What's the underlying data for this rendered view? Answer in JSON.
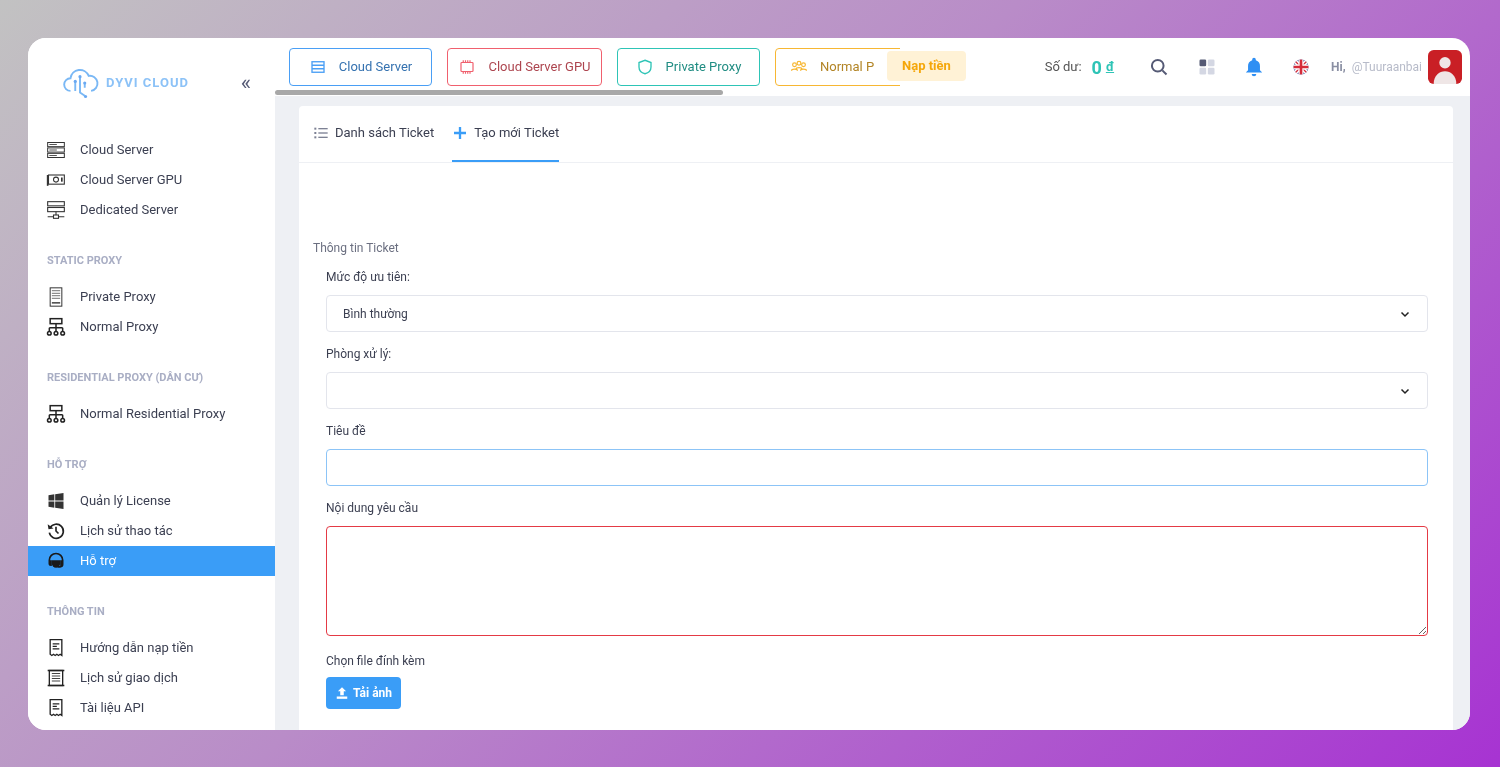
{
  "sidebar": {
    "logo": "DYVI CLOUD",
    "collapse": "«",
    "sections": [
      {
        "items": [
          {
            "label": "Cloud Server",
            "kind": "rack",
            "selected": false
          },
          {
            "label": "Cloud Server GPU",
            "kind": "gpu",
            "selected": false
          },
          {
            "label": "Dedicated Server",
            "kind": "dedicated",
            "selected": false
          }
        ]
      },
      {
        "heading": "STATIC PROXY",
        "items": [
          {
            "label": "Private Proxy",
            "kind": "panel",
            "selected": false
          },
          {
            "label": "Normal Proxy",
            "kind": "network",
            "selected": false
          }
        ]
      },
      {
        "heading": "RESIDENTIAL PROXY (DÂN CƯ)",
        "items": [
          {
            "label": "Normal Residential Proxy",
            "kind": "network",
            "selected": false
          }
        ]
      },
      {
        "heading": "HỖ TRỢ",
        "items": [
          {
            "label": "Quản lý License",
            "kind": "windows",
            "selected": false
          },
          {
            "label": "Lịch sử thao tác",
            "kind": "history",
            "selected": false
          },
          {
            "label": "Hỗ trợ",
            "kind": "headset",
            "selected": true
          }
        ]
      },
      {
        "heading": "THÔNG TIN",
        "items": [
          {
            "label": "Hướng dẫn nạp tiền",
            "kind": "receipt",
            "selected": false
          },
          {
            "label": "Lịch sử giao dịch",
            "kind": "scroll",
            "selected": false
          },
          {
            "label": "Tài liệu API",
            "kind": "receipt",
            "selected": false
          }
        ]
      }
    ]
  },
  "header": {
    "shortcuts": [
      {
        "label": "Cloud Server",
        "kind": "server",
        "color": "#4a9ff5"
      },
      {
        "label": "Cloud Server GPU",
        "kind": "chip",
        "color": "#f0606e"
      },
      {
        "label": "Private Proxy",
        "kind": "shield",
        "color": "#2ec4b6"
      },
      {
        "label": "Normal P",
        "kind": "people",
        "color": "#f7b733"
      }
    ],
    "topup_badge": "Nạp tiền",
    "balance_label": "Số dư:",
    "balance_value": "0",
    "balance_currency": "đ",
    "greeting": "Hi,",
    "username": "@Tuuraanbai"
  },
  "ticket_tabs": [
    {
      "label": "Danh sách Ticket",
      "kind": "list",
      "selected": false
    },
    {
      "label": "Tạo mới Ticket",
      "kind": "plus",
      "selected": true
    }
  ],
  "form": {
    "section_title": "Thông tin Ticket",
    "fields": [
      {
        "label": "Mức độ ưu tiên:",
        "kind": "select",
        "value": "Bình thường"
      },
      {
        "label": "Phòng xử lý:",
        "kind": "select"
      },
      {
        "label": "Tiêu đề",
        "kind": "text",
        "focused": true
      },
      {
        "label": "Nội dung yêu cầu",
        "kind": "textarea",
        "invalid": true
      }
    ],
    "attachment_label": "Chọn file đính kèm",
    "upload_button": "Tải ảnh"
  }
}
